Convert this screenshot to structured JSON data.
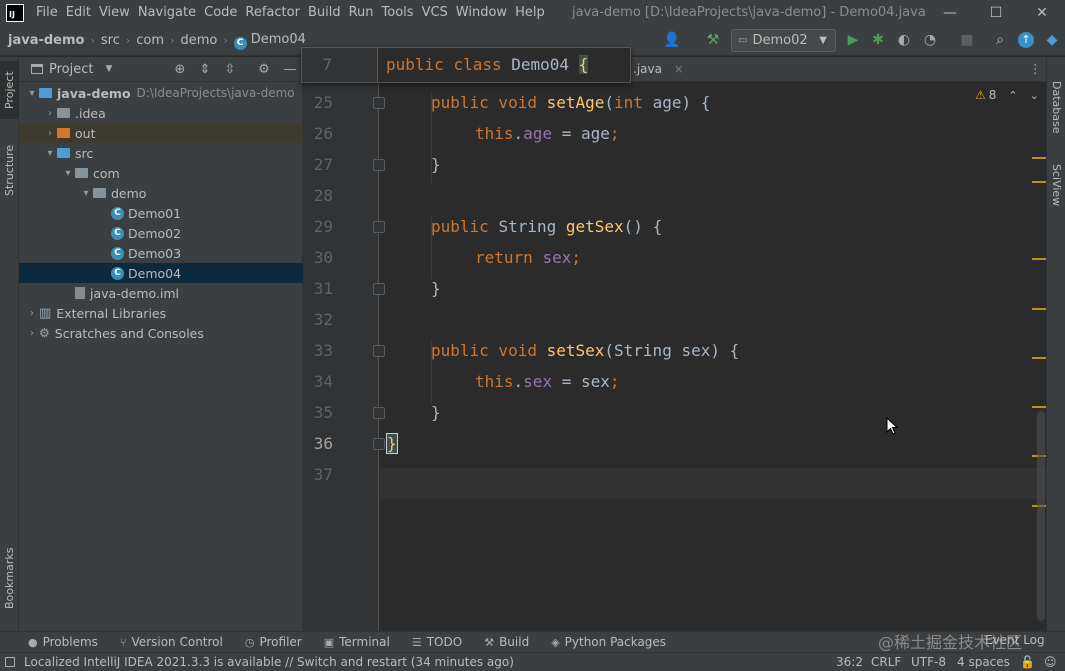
{
  "titlebar": {
    "logo_text": "IJ",
    "menu": [
      "File",
      "Edit",
      "View",
      "Navigate",
      "Code",
      "Refactor",
      "Build",
      "Run",
      "Tools",
      "VCS",
      "Window",
      "Help"
    ],
    "window_title": "java-demo [D:\\IdeaProjects\\java-demo] - Demo04.java",
    "controls": {
      "minimize": "—",
      "maximize": "☐",
      "close": "✕"
    }
  },
  "navbar": {
    "breadcrumbs": [
      "java-demo",
      "src",
      "com",
      "demo",
      "Demo04"
    ],
    "run_config": "Demo02",
    "class_icon_letter": "C"
  },
  "left_strip": {
    "tabs": [
      "Project",
      "Structure",
      "Bookmarks"
    ]
  },
  "right_strip": {
    "tabs": [
      "Database",
      "SciView"
    ]
  },
  "project_panel": {
    "title": "Project",
    "tree": [
      {
        "label": "java-demo",
        "hint": "D:\\IdeaProjects\\java-demo",
        "depth": 0,
        "arrow": "▾",
        "kind": "module"
      },
      {
        "label": ".idea",
        "depth": 1,
        "arrow": "›",
        "kind": "folder"
      },
      {
        "label": "out",
        "depth": 1,
        "arrow": "›",
        "kind": "folder-out"
      },
      {
        "label": "src",
        "depth": 1,
        "arrow": "▾",
        "kind": "folder-src"
      },
      {
        "label": "com",
        "depth": 2,
        "arrow": "▾",
        "kind": "package"
      },
      {
        "label": "demo",
        "depth": 3,
        "arrow": "▾",
        "kind": "package"
      },
      {
        "label": "Demo01",
        "depth": 4,
        "kind": "class"
      },
      {
        "label": "Demo02",
        "depth": 4,
        "kind": "class"
      },
      {
        "label": "Demo03",
        "depth": 4,
        "kind": "class"
      },
      {
        "label": "Demo04",
        "depth": 4,
        "kind": "class",
        "selected": true
      },
      {
        "label": "java-demo.iml",
        "depth": 2,
        "kind": "file"
      },
      {
        "label": "External Libraries",
        "depth": 0,
        "arrow": "›",
        "kind": "library"
      },
      {
        "label": "Scratches and Consoles",
        "depth": 0,
        "arrow": "›",
        "kind": "scratch"
      }
    ]
  },
  "editor": {
    "tab_suffix": ".java",
    "tab_close": "×",
    "sticky": {
      "line": "7",
      "code": [
        "public",
        " ",
        "class",
        " Demo04 ",
        "{"
      ]
    },
    "inspections": {
      "warnings": "8"
    },
    "lines": [
      {
        "no": "25",
        "tokens": [
          [
            "kw",
            "public"
          ],
          [
            "",
            ""
          ],
          [
            "kw",
            " void "
          ],
          [
            "fn",
            "setAge"
          ],
          [
            "",
            "("
          ],
          [
            "kw",
            "int"
          ],
          [
            "",
            " age) {"
          ]
        ],
        "indent": 1
      },
      {
        "no": "26",
        "tokens": [
          [
            "kw",
            "this"
          ],
          [
            "",
            "."
          ],
          [
            "fld",
            "age"
          ],
          [
            "",
            " = age"
          ],
          [
            "kw",
            ";"
          ]
        ],
        "indent": 2
      },
      {
        "no": "27",
        "tokens": [
          [
            "",
            "}"
          ]
        ],
        "indent": 1
      },
      {
        "no": "28",
        "tokens": [],
        "indent": 0
      },
      {
        "no": "29",
        "tokens": [
          [
            "kw",
            "public "
          ],
          [
            "",
            "String "
          ],
          [
            "fn",
            "getSex"
          ],
          [
            "",
            "() {"
          ]
        ],
        "indent": 1
      },
      {
        "no": "30",
        "tokens": [
          [
            "kw",
            "return "
          ],
          [
            "fld",
            "sex"
          ],
          [
            "kw",
            ";"
          ]
        ],
        "indent": 2
      },
      {
        "no": "31",
        "tokens": [
          [
            "",
            "}"
          ]
        ],
        "indent": 1
      },
      {
        "no": "32",
        "tokens": [],
        "indent": 0
      },
      {
        "no": "33",
        "tokens": [
          [
            "kw",
            "public void "
          ],
          [
            "fn",
            "setSex"
          ],
          [
            "",
            "(String sex) {"
          ]
        ],
        "indent": 1
      },
      {
        "no": "34",
        "tokens": [
          [
            "kw",
            "this"
          ],
          [
            "",
            "."
          ],
          [
            "fld",
            "sex"
          ],
          [
            "",
            " = sex"
          ],
          [
            "kw",
            ";"
          ]
        ],
        "indent": 2
      },
      {
        "no": "35",
        "tokens": [
          [
            "",
            "}"
          ]
        ],
        "indent": 1
      },
      {
        "no": "36",
        "tokens": [
          [
            "fn",
            "}"
          ]
        ],
        "indent": 0,
        "current": true
      },
      {
        "no": "37",
        "tokens": [],
        "indent": 0
      }
    ]
  },
  "bottom_tools": [
    {
      "icon": "●",
      "label": "Problems"
    },
    {
      "icon": "⑂",
      "label": "Version Control"
    },
    {
      "icon": "◷",
      "label": "Profiler"
    },
    {
      "icon": "▣",
      "label": "Terminal"
    },
    {
      "icon": "☰",
      "label": "TODO"
    },
    {
      "icon": "⚒",
      "label": "Build"
    },
    {
      "icon": "◈",
      "label": "Python Packages"
    }
  ],
  "statusbar": {
    "message": "Localized IntelliJ IDEA 2021.3.3 is available // Switch and restart (34 minutes ago)",
    "position": "36:2",
    "line_sep": "CRLF",
    "encoding": "UTF-8",
    "indent": "4 spaces"
  },
  "watermark": "@稀土掘金技术社区",
  "event_log": "Event Log",
  "colors": {
    "keyword": "#cc7832",
    "field": "#9876aa",
    "method": "#ffc66d",
    "text": "#a9b7c6",
    "selection": "#0d293e",
    "warning_stripe": "#be9117"
  }
}
